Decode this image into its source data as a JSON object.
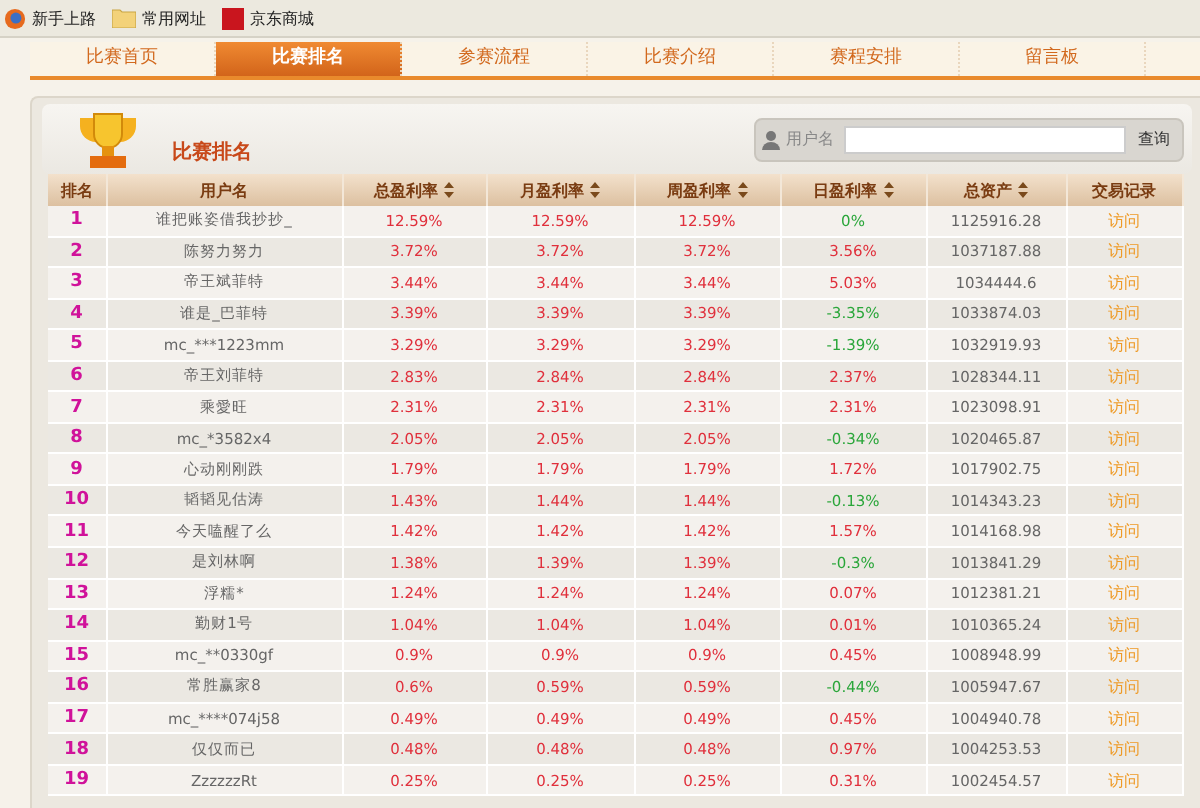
{
  "bookmarks": [
    {
      "label": "新手上路"
    },
    {
      "label": "常用网址"
    },
    {
      "label": "京东商城"
    }
  ],
  "nav": [
    {
      "label": "比赛首页",
      "selected": false
    },
    {
      "label": "比赛排名",
      "selected": true
    },
    {
      "label": "参赛流程",
      "selected": false
    },
    {
      "label": "比赛介绍",
      "selected": false
    },
    {
      "label": "赛程安排",
      "selected": false
    },
    {
      "label": "留言板",
      "selected": false
    }
  ],
  "panel": {
    "title": "比赛排名",
    "search": {
      "label": "用户名",
      "button": "查询"
    }
  },
  "table": {
    "columns": [
      {
        "label": "排名",
        "sortable": false
      },
      {
        "label": "用户名",
        "sortable": false
      },
      {
        "label": "总盈利率",
        "sortable": true
      },
      {
        "label": "月盈利率",
        "sortable": true
      },
      {
        "label": "周盈利率",
        "sortable": true
      },
      {
        "label": "日盈利率",
        "sortable": true
      },
      {
        "label": "总资产",
        "sortable": true
      },
      {
        "label": "交易记录",
        "sortable": false
      }
    ],
    "rows": [
      {
        "rank": "1",
        "user": "谁把账姿借我抄抄_",
        "total": "12.59%",
        "month": "12.59%",
        "week": "12.59%",
        "day": "0%",
        "day_up": false,
        "assets": "1125916.28",
        "link": "访问"
      },
      {
        "rank": "2",
        "user": "陈努力努力",
        "total": "3.72%",
        "month": "3.72%",
        "week": "3.72%",
        "day": "3.56%",
        "day_up": true,
        "assets": "1037187.88",
        "link": "访问"
      },
      {
        "rank": "3",
        "user": "帝王斌菲特",
        "total": "3.44%",
        "month": "3.44%",
        "week": "3.44%",
        "day": "5.03%",
        "day_up": true,
        "assets": "1034444.6",
        "link": "访问"
      },
      {
        "rank": "4",
        "user": "谁是_巴菲特",
        "total": "3.39%",
        "month": "3.39%",
        "week": "3.39%",
        "day": "-3.35%",
        "day_up": false,
        "assets": "1033874.03",
        "link": "访问"
      },
      {
        "rank": "5",
        "user": "mc_***1223mm",
        "total": "3.29%",
        "month": "3.29%",
        "week": "3.29%",
        "day": "-1.39%",
        "day_up": false,
        "assets": "1032919.93",
        "link": "访问"
      },
      {
        "rank": "6",
        "user": "帝王刘菲特",
        "total": "2.83%",
        "month": "2.84%",
        "week": "2.84%",
        "day": "2.37%",
        "day_up": true,
        "assets": "1028344.11",
        "link": "访问"
      },
      {
        "rank": "7",
        "user": "乘愛旺",
        "total": "2.31%",
        "month": "2.31%",
        "week": "2.31%",
        "day": "2.31%",
        "day_up": true,
        "assets": "1023098.91",
        "link": "访问"
      },
      {
        "rank": "8",
        "user": "mc_*3582x4",
        "total": "2.05%",
        "month": "2.05%",
        "week": "2.05%",
        "day": "-0.34%",
        "day_up": false,
        "assets": "1020465.87",
        "link": "访问"
      },
      {
        "rank": "9",
        "user": "心动刚刚跌",
        "total": "1.79%",
        "month": "1.79%",
        "week": "1.79%",
        "day": "1.72%",
        "day_up": true,
        "assets": "1017902.75",
        "link": "访问"
      },
      {
        "rank": "10",
        "user": "韬韬见估涛",
        "total": "1.43%",
        "month": "1.44%",
        "week": "1.44%",
        "day": "-0.13%",
        "day_up": false,
        "assets": "1014343.23",
        "link": "访问"
      },
      {
        "rank": "11",
        "user": "今天嗑醒了么",
        "total": "1.42%",
        "month": "1.42%",
        "week": "1.42%",
        "day": "1.57%",
        "day_up": true,
        "assets": "1014168.98",
        "link": "访问"
      },
      {
        "rank": "12",
        "user": "是刘林啊",
        "total": "1.38%",
        "month": "1.39%",
        "week": "1.39%",
        "day": "-0.3%",
        "day_up": false,
        "assets": "1013841.29",
        "link": "访问"
      },
      {
        "rank": "13",
        "user": "浮糯*",
        "total": "1.24%",
        "month": "1.24%",
        "week": "1.24%",
        "day": "0.07%",
        "day_up": true,
        "assets": "1012381.21",
        "link": "访问"
      },
      {
        "rank": "14",
        "user": "勤财1号",
        "total": "1.04%",
        "month": "1.04%",
        "week": "1.04%",
        "day": "0.01%",
        "day_up": true,
        "assets": "1010365.24",
        "link": "访问"
      },
      {
        "rank": "15",
        "user": "mc_**0330gf",
        "total": "0.9%",
        "month": "0.9%",
        "week": "0.9%",
        "day": "0.45%",
        "day_up": true,
        "assets": "1008948.99",
        "link": "访问"
      },
      {
        "rank": "16",
        "user": "常胜赢家8",
        "total": "0.6%",
        "month": "0.59%",
        "week": "0.59%",
        "day": "-0.44%",
        "day_up": false,
        "assets": "1005947.67",
        "link": "访问"
      },
      {
        "rank": "17",
        "user": "mc_****074j58",
        "total": "0.49%",
        "month": "0.49%",
        "week": "0.49%",
        "day": "0.45%",
        "day_up": true,
        "assets": "1004940.78",
        "link": "访问"
      },
      {
        "rank": "18",
        "user": "仅仅而已",
        "total": "0.48%",
        "month": "0.48%",
        "week": "0.48%",
        "day": "0.97%",
        "day_up": true,
        "assets": "1004253.53",
        "link": "访问"
      },
      {
        "rank": "19",
        "user": "ZzzzzzRt",
        "total": "0.25%",
        "month": "0.25%",
        "week": "0.25%",
        "day": "0.31%",
        "day_up": true,
        "assets": "1002454.57",
        "link": "访问"
      }
    ]
  }
}
